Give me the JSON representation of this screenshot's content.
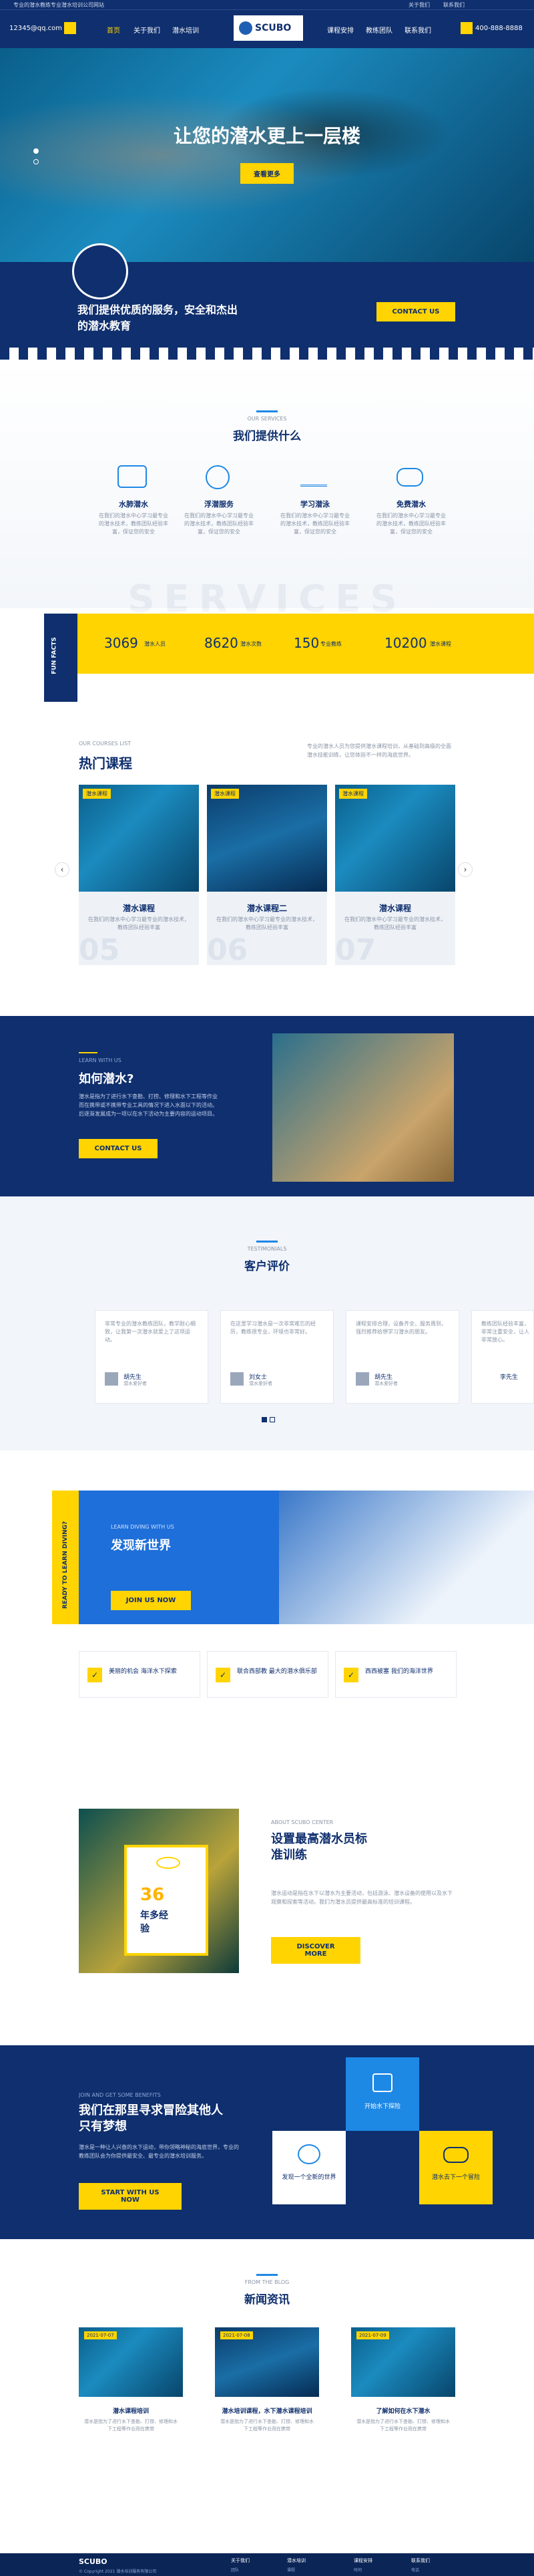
{
  "topbar": {
    "notice": "专业的潜水教练专业潜水培训公司网站",
    "link1": "关于我们",
    "link2": "联系我们"
  },
  "header": {
    "email": "12345@qq.com",
    "nav": [
      "首页",
      "关于我们",
      "潜水培训",
      "课程安排",
      "教练团队",
      "联系我们"
    ],
    "logo": "SCUBO",
    "phone": "400-888-8888"
  },
  "hero": {
    "title": "让您的潜水更上一层楼",
    "button": "查看更多"
  },
  "cta_band": {
    "text": "我们提供优质的服务，安全和杰出的潜水教育",
    "button": "CONTACT US"
  },
  "services": {
    "kicker": "OUR SERVICES",
    "title": "我们提供什么",
    "watermark": "SERVICES",
    "items": [
      {
        "title": "水肺潜水",
        "desc": "在我们的潜水中心学习最专业的潜水技术，教练团队经验丰富，保证您的安全"
      },
      {
        "title": "浮潜服务",
        "desc": "在我们的潜水中心学习最专业的潜水技术，教练团队经验丰富，保证您的安全"
      },
      {
        "title": "学习潜泳",
        "desc": "在我们的潜水中心学习最专业的潜水技术，教练团队经验丰富，保证您的安全"
      },
      {
        "title": "免费潜水",
        "desc": "在我们的潜水中心学习最专业的潜水技术，教练团队经验丰富，保证您的安全"
      }
    ]
  },
  "facts": {
    "label": "FUN FACTS",
    "items": [
      {
        "num": "3069",
        "label": "潜水人员"
      },
      {
        "num": "8620",
        "label": "潜水次数"
      },
      {
        "num": "150",
        "label": "专业教练"
      },
      {
        "num": "10200",
        "label": "潜水课程"
      }
    ]
  },
  "courses": {
    "kicker": "OUR COURSES LIST",
    "title": "热门课程",
    "intro": "专业的潜水人员为您提供潜水课程培训，从基础到高级的全面潜水技能训练，让您体验不一样的海底世界。",
    "items": [
      {
        "tag": "潜水课程",
        "title": "潜水课程",
        "desc": "在我们的潜水中心学习最专业的潜水技术，教练团队经验丰富",
        "num": "05"
      },
      {
        "tag": "潜水课程",
        "title": "潜水课程二",
        "desc": "在我们的潜水中心学习最专业的潜水技术，教练团队经验丰富",
        "num": "06"
      },
      {
        "tag": "潜水课程",
        "title": "潜水课程",
        "desc": "在我们的潜水中心学习最专业的潜水技术，教练团队经验丰富",
        "num": "07"
      }
    ]
  },
  "learn": {
    "kicker": "LEARN WITH US",
    "title": "如何潜水?",
    "desc": "潜水是指为了进行水下查勘、打捞、修理和水下工程等作业而在携带或不携带专业工具的情况下进入水面以下的活动。后逐渐发展成为一项以在水下活动为主要内容的运动项目。",
    "button": "CONTACT US"
  },
  "testimonials": {
    "kicker": "TESTIMONIALS",
    "title": "客户评价",
    "items": [
      {
        "text": "非常专业的潜水教练团队，教学耐心细致，让我第一次潜水就爱上了这项运动。",
        "name": "胡先生",
        "role": "潜水爱好者"
      },
      {
        "text": "在这里学习潜水是一次非常难忘的经历，教练很专业，环境也非常好。",
        "name": "刘女士",
        "role": "潜水爱好者"
      },
      {
        "text": "课程安排合理，设备齐全，服务周到，强烈推荐给想学习潜水的朋友。",
        "name": "胡先生",
        "role": "潜水爱好者"
      },
      {
        "text": "教练团队经验丰富，非常注重安全，让人非常放心。",
        "name": "李先生",
        "role": "潜水爱好者"
      }
    ]
  },
  "discover": {
    "side": "READY TO LEARN DIVING?",
    "kicker": "LEARN DIVING WITH US",
    "title": "发现新世界",
    "button": "JOIN US NOW",
    "features": [
      {
        "text": "美丽的机会 海洋水下探索"
      },
      {
        "text": "联合西部教 最大的潜水俱乐部"
      },
      {
        "text": "西西被塞 我们的海洋世界"
      }
    ]
  },
  "about": {
    "kicker": "ABOUT SCUBO CENTER",
    "title": "设置最高潜水员标准训练",
    "desc": "潜水运动是指在水下以潜水为主要活动，包括游泳、潜水设备的使用以及水下观察和探索等活动。我们为潜水员提供最高标准的培训课程。",
    "years": "36",
    "years_label": "年多经验",
    "button": "DISCOVER MORE"
  },
  "adventure": {
    "kicker": "JOIN AND GET SOME BENEFITS",
    "title": "我们在那里寻求冒险其他人只有梦想",
    "desc": "潜水是一种让人兴奋的水下运动，带你领略神秘的海底世界，专业的教练团队会为你提供最安全、最专业的潜水培训服务。",
    "button": "START WITH US NOW",
    "tiles": [
      {
        "text": "开始水下探险"
      },
      {
        "text": "发现一个全新的世界"
      },
      {
        "text": "潜水去下一个冒险"
      }
    ]
  },
  "news": {
    "kicker": "FROM THE BLOG",
    "title": "新闻资讯",
    "items": [
      {
        "date": "2021-07-07",
        "title": "潜水课程培训",
        "desc": "潜水是指为了进行水下查勘、打捞、修理和水下工程等作业而在携带"
      },
      {
        "date": "2021-07-08",
        "title": "潜水培训课程，水下潜水课程培训",
        "desc": "潜水是指为了进行水下查勘、打捞、修理和水下工程等作业而在携带"
      },
      {
        "date": "2021-07-09",
        "title": "了解如何在水下潜水",
        "desc": "潜水是指为了进行水下查勘、打捞、修理和水下工程等作业而在携带"
      }
    ]
  },
  "footer": {
    "logo": "SCUBO",
    "copyright": "© Copyright 2021 潜水培训服务有限公司",
    "cols": [
      {
        "head": "关于我们",
        "items": [
          "团队",
          "历史"
        ]
      },
      {
        "head": "潜水培训",
        "items": [
          "课程",
          "教练"
        ]
      },
      {
        "head": "课程安排",
        "items": [
          "时间",
          "价格"
        ]
      },
      {
        "head": "联系我们",
        "items": [
          "电话",
          "邮箱"
        ]
      }
    ]
  },
  "colors": {
    "navy": "#0f2f6e",
    "yellow": "#ffd400",
    "blue": "#1e88e5"
  }
}
